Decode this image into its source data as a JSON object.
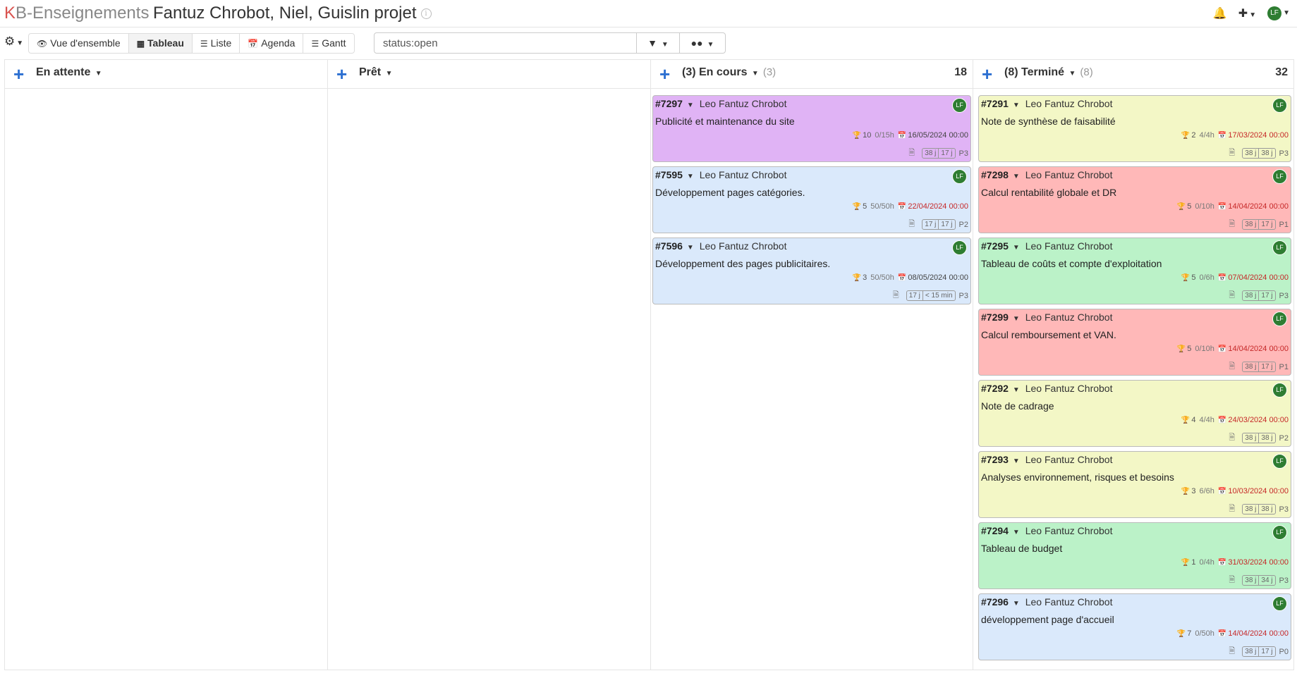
{
  "header": {
    "logo_k": "K",
    "logo_rest": "B-Enseignements",
    "project_title": "Fantuz Chrobot, Niel, Guislin projet",
    "info_icon": "info-icon",
    "user_initials": "LF"
  },
  "toolbar": {
    "views": [
      {
        "label": "Vue d'ensemble",
        "icon": "eye-icon"
      },
      {
        "label": "Tableau",
        "icon": "grid-icon",
        "active": true
      },
      {
        "label": "Liste",
        "icon": "list-icon"
      },
      {
        "label": "Agenda",
        "icon": "calendar-icon"
      },
      {
        "label": "Gantt",
        "icon": "sliders-icon"
      }
    ],
    "search_value": "status:open"
  },
  "columns": [
    {
      "title": "En attente",
      "count": "",
      "score": ""
    },
    {
      "title": "Prêt",
      "count": "",
      "score": ""
    },
    {
      "title": "(3) En cours",
      "count": "(3)",
      "score": "18"
    },
    {
      "title": "(8) Terminé",
      "count": "(8)",
      "score": "32"
    }
  ],
  "cards": {
    "c7297": {
      "id": "#7297",
      "assignee": "Leo Fantuz Chrobot",
      "avatar": "LF",
      "title": "Publicité et maintenance du site",
      "score": "10",
      "time": "0/15h",
      "due": "16/05/2024 00:00",
      "d1": "38 j",
      "d2": "17 j",
      "prio": "P3",
      "color": "#e0b3f5"
    },
    "c7595": {
      "id": "#7595",
      "assignee": "Leo Fantuz Chrobot",
      "avatar": "LF",
      "title": "Développement pages catégories.",
      "score": "5",
      "time": "50/50h",
      "due": "22/04/2024 00:00",
      "d1": "17 j",
      "d2": "17 j",
      "prio": "P2",
      "color": "#dae9fb"
    },
    "c7596": {
      "id": "#7596",
      "assignee": "Leo Fantuz Chrobot",
      "avatar": "LF",
      "title": "Développement des pages publicitaires.",
      "score": "3",
      "time": "50/50h",
      "due": "08/05/2024 00:00",
      "d1": "17 j",
      "d2": "< 15 min",
      "prio": "P3",
      "color": "#dae9fb"
    },
    "c7291": {
      "id": "#7291",
      "assignee": "Leo Fantuz Chrobot",
      "avatar": "LF",
      "title": "Note de synthèse de faisabilité",
      "score": "2",
      "time": "4/4h",
      "due": "17/03/2024 00:00",
      "d1": "38 j",
      "d2": "38 j",
      "prio": "P3",
      "color": "#f3f7c6"
    },
    "c7298": {
      "id": "#7298",
      "assignee": "Leo Fantuz Chrobot",
      "avatar": "LF",
      "title": "Calcul rentabilité globale et DR",
      "score": "5",
      "time": "0/10h",
      "due": "14/04/2024 00:00",
      "d1": "38 j",
      "d2": "17 j",
      "prio": "P1",
      "color": "#ffb8b8"
    },
    "c7295": {
      "id": "#7295",
      "assignee": "Leo Fantuz Chrobot",
      "avatar": "LF",
      "title": "Tableau de coûts et compte d'exploitation",
      "score": "5",
      "time": "0/6h",
      "due": "07/04/2024 00:00",
      "d1": "38 j",
      "d2": "17 j",
      "prio": "P3",
      "color": "#bbf2c8"
    },
    "c7299": {
      "id": "#7299",
      "assignee": "Leo Fantuz Chrobot",
      "avatar": "LF",
      "title": "Calcul remboursement et VAN.",
      "score": "5",
      "time": "0/10h",
      "due": "14/04/2024 00:00",
      "d1": "38 j",
      "d2": "17 j",
      "prio": "P1",
      "color": "#ffb8b8"
    },
    "c7292": {
      "id": "#7292",
      "assignee": "Leo Fantuz Chrobot",
      "avatar": "LF",
      "title": "Note de cadrage",
      "score": "4",
      "time": "4/4h",
      "due": "24/03/2024 00:00",
      "d1": "38 j",
      "d2": "38 j",
      "prio": "P2",
      "color": "#f3f7c6"
    },
    "c7293": {
      "id": "#7293",
      "assignee": "Leo Fantuz Chrobot",
      "avatar": "LF",
      "title": "Analyses environnement, risques et besoins",
      "score": "3",
      "time": "6/6h",
      "due": "10/03/2024 00:00",
      "d1": "38 j",
      "d2": "38 j",
      "prio": "P3",
      "color": "#f3f7c6"
    },
    "c7294": {
      "id": "#7294",
      "assignee": "Leo Fantuz Chrobot",
      "avatar": "LF",
      "title": "Tableau de budget",
      "score": "1",
      "time": "0/4h",
      "due": "31/03/2024 00:00",
      "d1": "38 j",
      "d2": "34 j",
      "prio": "P3",
      "color": "#bbf2c8"
    },
    "c7296": {
      "id": "#7296",
      "assignee": "Leo Fantuz Chrobot",
      "avatar": "LF",
      "title": "développement page d'accueil",
      "score": "7",
      "time": "0/50h",
      "due": "14/04/2024 00:00",
      "d1": "38 j",
      "d2": "17 j",
      "prio": "P0",
      "color": "#dae9fb"
    }
  }
}
